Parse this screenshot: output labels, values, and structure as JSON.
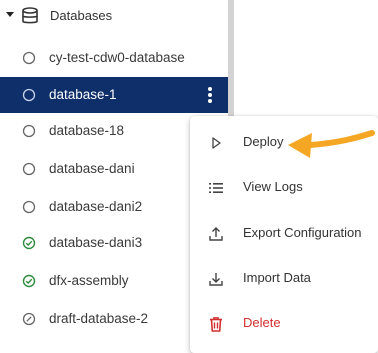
{
  "tree": {
    "root_label": "Databases",
    "items": [
      {
        "label": "cy-test-cdw0-database",
        "status": "circle-outline-icon"
      },
      {
        "label": "database-1",
        "status": "circle-outline-icon",
        "selected": true
      },
      {
        "label": "database-18",
        "status": "circle-outline-icon"
      },
      {
        "label": "database-dani",
        "status": "circle-outline-icon"
      },
      {
        "label": "database-dani2",
        "status": "circle-outline-icon"
      },
      {
        "label": "database-dani3",
        "status": "check-circle-icon"
      },
      {
        "label": "dfx-assembly",
        "status": "check-circle-icon"
      },
      {
        "label": "draft-database-2",
        "status": "draft-slash-icon"
      }
    ]
  },
  "menu": {
    "items": [
      {
        "label": "Deploy",
        "icon": "play-icon"
      },
      {
        "label": "View Logs",
        "icon": "list-icon"
      },
      {
        "label": "Export Configuration",
        "icon": "upload-icon"
      },
      {
        "label": "Import Data",
        "icon": "download-icon"
      },
      {
        "label": "Delete",
        "icon": "trash-icon"
      }
    ]
  },
  "colors": {
    "selected_bg": "#0f2f6b",
    "success": "#2e8b3d",
    "danger": "#d32f2f",
    "annotation_arrow": "#f5a623"
  }
}
